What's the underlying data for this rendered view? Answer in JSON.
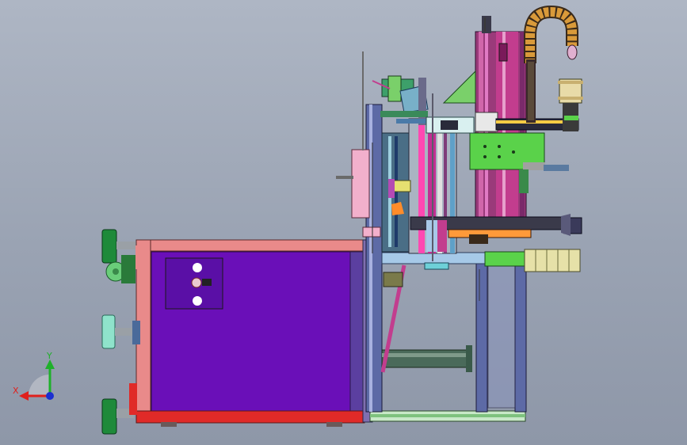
{
  "viewport": {
    "background_top": "#aeb6c4",
    "background_bottom": "#8e97a8"
  },
  "triad": {
    "x_label": "X",
    "y_label": "Y",
    "x_color": "#e0201c",
    "y_color": "#1fb02a",
    "z_color": "#1b2fd0"
  },
  "model": {
    "cabinet_panel_color": "#6a0fb8",
    "frame_red": "#e02a28",
    "frame_pink": "#e98a8a",
    "machine_green": "#5ad24a",
    "tower_pink": "#c23d8e",
    "cable_chain_color": "#d99a3a"
  }
}
